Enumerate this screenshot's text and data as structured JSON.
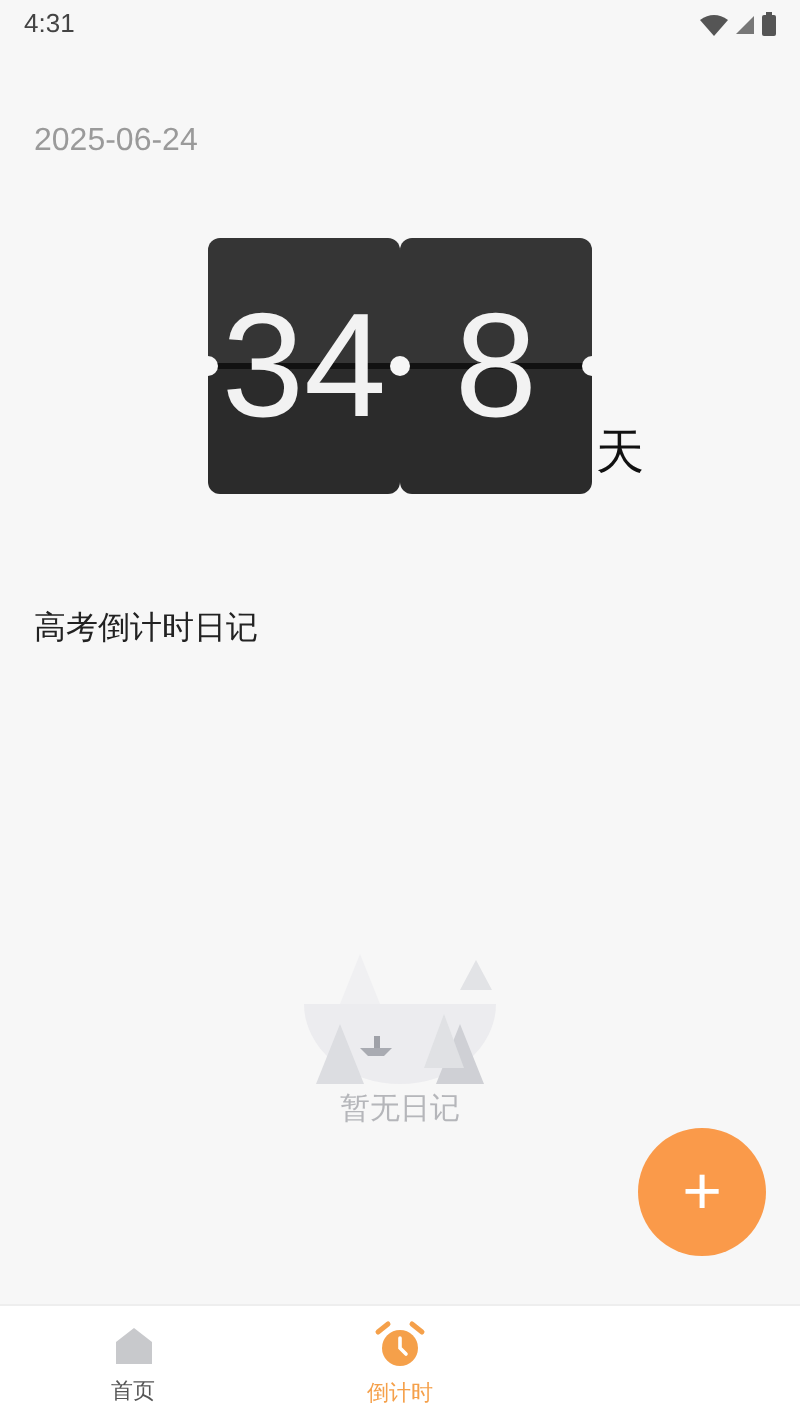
{
  "status_bar": {
    "time": "4:31"
  },
  "date": "2025-06-24",
  "countdown": {
    "digits": [
      "34",
      "8"
    ],
    "unit": "天"
  },
  "diary_title": "高考倒计时日记",
  "empty_state": {
    "text": "暂无日记"
  },
  "fab": {
    "label": "+"
  },
  "tabs": [
    {
      "label": "首页",
      "kind": "home",
      "selected": false
    },
    {
      "label": "倒计时",
      "kind": "alarm",
      "selected": true
    }
  ]
}
